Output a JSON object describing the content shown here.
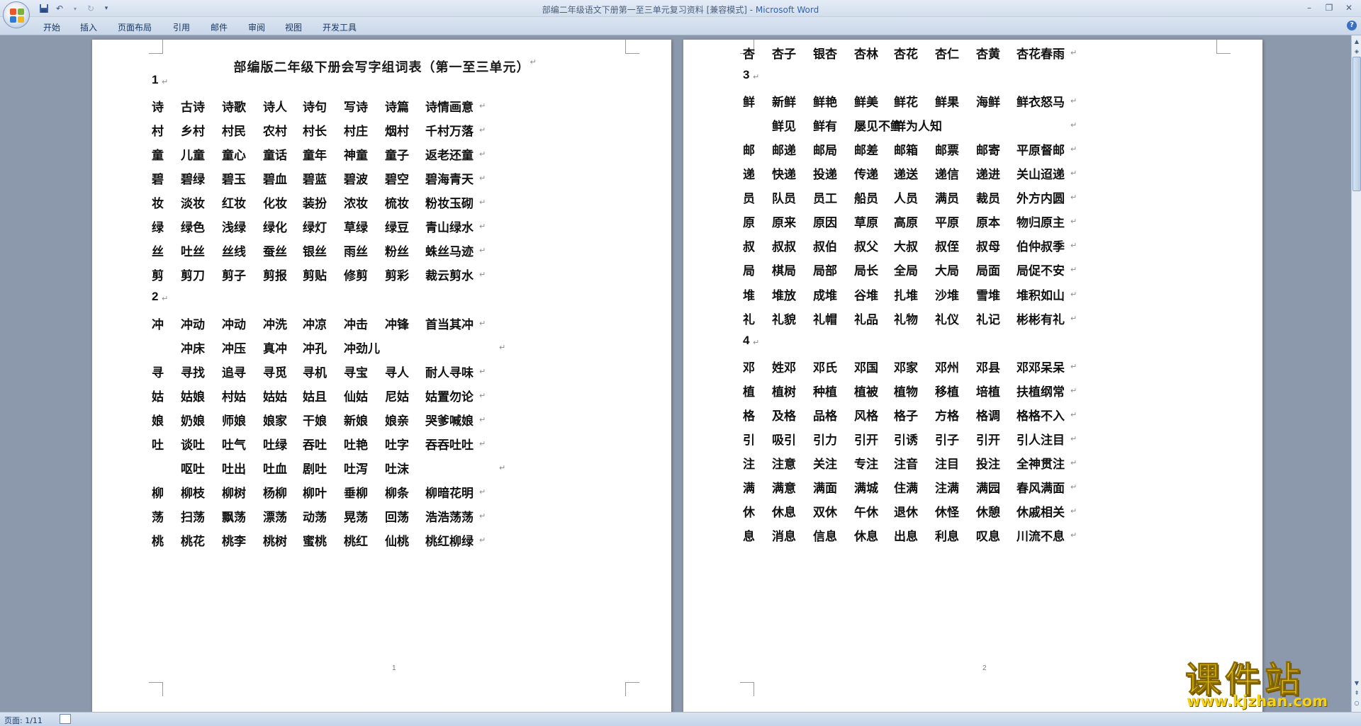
{
  "window": {
    "title": "部编二年级语文下册第一至三单元复习资料 [兼容模式] - ",
    "app_name": "Microsoft Word"
  },
  "ribbon": {
    "tabs": [
      "开始",
      "插入",
      "页面布局",
      "引用",
      "邮件",
      "审阅",
      "视图",
      "开发工具"
    ]
  },
  "status": {
    "page": "页面: 1/11"
  },
  "watermark": {
    "brand": "课件站",
    "url": "www.kjzhan.com"
  },
  "page1": {
    "title": "部编版二年级下册会写字组词表（第一至三单元）",
    "page_number": "1",
    "rows": [
      {
        "type": "section",
        "cells": [
          "1"
        ]
      },
      {
        "type": "words",
        "cells": [
          "诗",
          "古诗",
          "诗歌",
          "诗人",
          "诗句",
          "写诗",
          "诗篇",
          "诗情画意"
        ]
      },
      {
        "type": "words",
        "cells": [
          "村",
          "乡村",
          "村民",
          "农村",
          "村长",
          "村庄",
          "烟村",
          "千村万落"
        ]
      },
      {
        "type": "words",
        "cells": [
          "童",
          "儿童",
          "童心",
          "童话",
          "童年",
          "神童",
          "童子",
          "返老还童"
        ]
      },
      {
        "type": "words",
        "cells": [
          "碧",
          "碧绿",
          "碧玉",
          "碧血",
          "碧蓝",
          "碧波",
          "碧空",
          "碧海青天"
        ]
      },
      {
        "type": "words",
        "cells": [
          "妆",
          "淡妆",
          "红妆",
          "化妆",
          "装扮",
          "浓妆",
          "梳妆",
          "粉妆玉砌"
        ]
      },
      {
        "type": "words",
        "cells": [
          "绿",
          "绿色",
          "浅绿",
          "绿化",
          "绿灯",
          "草绿",
          "绿豆",
          "青山绿水"
        ]
      },
      {
        "type": "words",
        "cells": [
          "丝",
          "吐丝",
          "丝线",
          "蚕丝",
          "银丝",
          "雨丝",
          "粉丝",
          "蛛丝马迹"
        ]
      },
      {
        "type": "words",
        "cells": [
          "剪",
          "剪刀",
          "剪子",
          "剪报",
          "剪贴",
          "修剪",
          "剪彩",
          "裁云剪水"
        ]
      },
      {
        "type": "section",
        "cells": [
          "2"
        ]
      },
      {
        "type": "words",
        "cells": [
          "冲",
          "冲动",
          "冲动",
          "冲洗",
          "冲凉",
          "冲击",
          "冲锋",
          "首当其冲"
        ]
      },
      {
        "type": "cont",
        "cells": [
          "冲床",
          "冲压",
          "真冲",
          "冲孔",
          "冲劲儿"
        ]
      },
      {
        "type": "words",
        "cells": [
          "寻",
          "寻找",
          "追寻",
          "寻觅",
          "寻机",
          "寻宝",
          "寻人",
          "耐人寻味"
        ]
      },
      {
        "type": "words",
        "cells": [
          "姑",
          "姑娘",
          "村姑",
          "姑姑",
          "姑且",
          "仙姑",
          "尼姑",
          "姑置勿论"
        ]
      },
      {
        "type": "words",
        "cells": [
          "娘",
          "奶娘",
          "师娘",
          "娘家",
          "干娘",
          "新娘",
          "娘亲",
          "哭爹喊娘"
        ]
      },
      {
        "type": "words",
        "cells": [
          "吐",
          "谈吐",
          "吐气",
          "吐绿",
          "吞吐",
          "吐艳",
          "吐字",
          "吞吞吐吐"
        ]
      },
      {
        "type": "cont",
        "cells": [
          "呕吐",
          "吐出",
          "吐血",
          "剧吐",
          "吐泻",
          "吐沫"
        ]
      },
      {
        "type": "words",
        "cells": [
          "柳",
          "柳枝",
          "柳树",
          "杨柳",
          "柳叶",
          "垂柳",
          "柳条",
          "柳暗花明"
        ]
      },
      {
        "type": "words",
        "cells": [
          "荡",
          "扫荡",
          "飘荡",
          "漂荡",
          "动荡",
          "晃荡",
          "回荡",
          "浩浩荡荡"
        ]
      },
      {
        "type": "words",
        "cells": [
          "桃",
          "桃花",
          "桃李",
          "桃树",
          "蜜桃",
          "桃红",
          "仙桃",
          "桃红柳绿"
        ]
      }
    ]
  },
  "page2": {
    "page_number": "2",
    "rows": [
      {
        "type": "words",
        "cells": [
          "杏",
          "杏子",
          "银杏",
          "杏林",
          "杏花",
          "杏仁",
          "杏黄",
          "杏花春雨"
        ]
      },
      {
        "type": "section",
        "cells": [
          "3"
        ]
      },
      {
        "type": "words",
        "cells": [
          "鲜",
          "新鲜",
          "鲜艳",
          "鲜美",
          "鲜花",
          "鲜果",
          "海鲜",
          "鲜衣怒马"
        ]
      },
      {
        "type": "cont",
        "cells": [
          "鲜见",
          "鲜有",
          "屡见不鲜",
          "鲜为人知"
        ]
      },
      {
        "type": "words",
        "cells": [
          "邮",
          "邮递",
          "邮局",
          "邮差",
          "邮箱",
          "邮票",
          "邮寄",
          "平原督邮"
        ]
      },
      {
        "type": "words",
        "cells": [
          "递",
          "快递",
          "投递",
          "传递",
          "递送",
          "递信",
          "递进",
          "关山迢递"
        ]
      },
      {
        "type": "words",
        "cells": [
          "员",
          "队员",
          "员工",
          "船员",
          "人员",
          "满员",
          "裁员",
          "外方内圆"
        ]
      },
      {
        "type": "words",
        "cells": [
          "原",
          "原来",
          "原因",
          "草原",
          "高原",
          "平原",
          "原本",
          "物归原主"
        ]
      },
      {
        "type": "words",
        "cells": [
          "叔",
          "叔叔",
          "叔伯",
          "叔父",
          "大叔",
          "叔侄",
          "叔母",
          "伯仲叔季"
        ]
      },
      {
        "type": "words",
        "cells": [
          "局",
          "棋局",
          "局部",
          "局长",
          "全局",
          "大局",
          "局面",
          "局促不安"
        ]
      },
      {
        "type": "words",
        "cells": [
          "堆",
          "堆放",
          "成堆",
          "谷堆",
          "扎堆",
          "沙堆",
          "雪堆",
          "堆积如山"
        ]
      },
      {
        "type": "words",
        "cells": [
          "礼",
          "礼貌",
          "礼帽",
          "礼品",
          "礼物",
          "礼仪",
          "礼记",
          "彬彬有礼"
        ]
      },
      {
        "type": "section",
        "cells": [
          "4"
        ]
      },
      {
        "type": "words",
        "cells": [
          "邓",
          "姓邓",
          "邓氏",
          "邓国",
          "邓家",
          "邓州",
          "邓县",
          "邓邓呆呆"
        ]
      },
      {
        "type": "words",
        "cells": [
          "植",
          "植树",
          "种植",
          "植被",
          "植物",
          "移植",
          "培植",
          "扶植纲常"
        ]
      },
      {
        "type": "words",
        "cells": [
          "格",
          "及格",
          "品格",
          "风格",
          "格子",
          "方格",
          "格调",
          "格格不入"
        ]
      },
      {
        "type": "words",
        "cells": [
          "引",
          "吸引",
          "引力",
          "引开",
          "引诱",
          "引子",
          "引开",
          "引人注目"
        ]
      },
      {
        "type": "words",
        "cells": [
          "注",
          "注意",
          "关注",
          "专注",
          "注音",
          "注目",
          "投注",
          "全神贯注"
        ]
      },
      {
        "type": "words",
        "cells": [
          "满",
          "满意",
          "满面",
          "满城",
          "住满",
          "注满",
          "满园",
          "春风满面"
        ]
      },
      {
        "type": "words",
        "cells": [
          "休",
          "休息",
          "双休",
          "午休",
          "退休",
          "休怪",
          "休憩",
          "休戚相关"
        ]
      },
      {
        "type": "words",
        "cells": [
          "息",
          "消息",
          "信息",
          "休息",
          "出息",
          "利息",
          "叹息",
          "川流不息"
        ]
      }
    ]
  }
}
